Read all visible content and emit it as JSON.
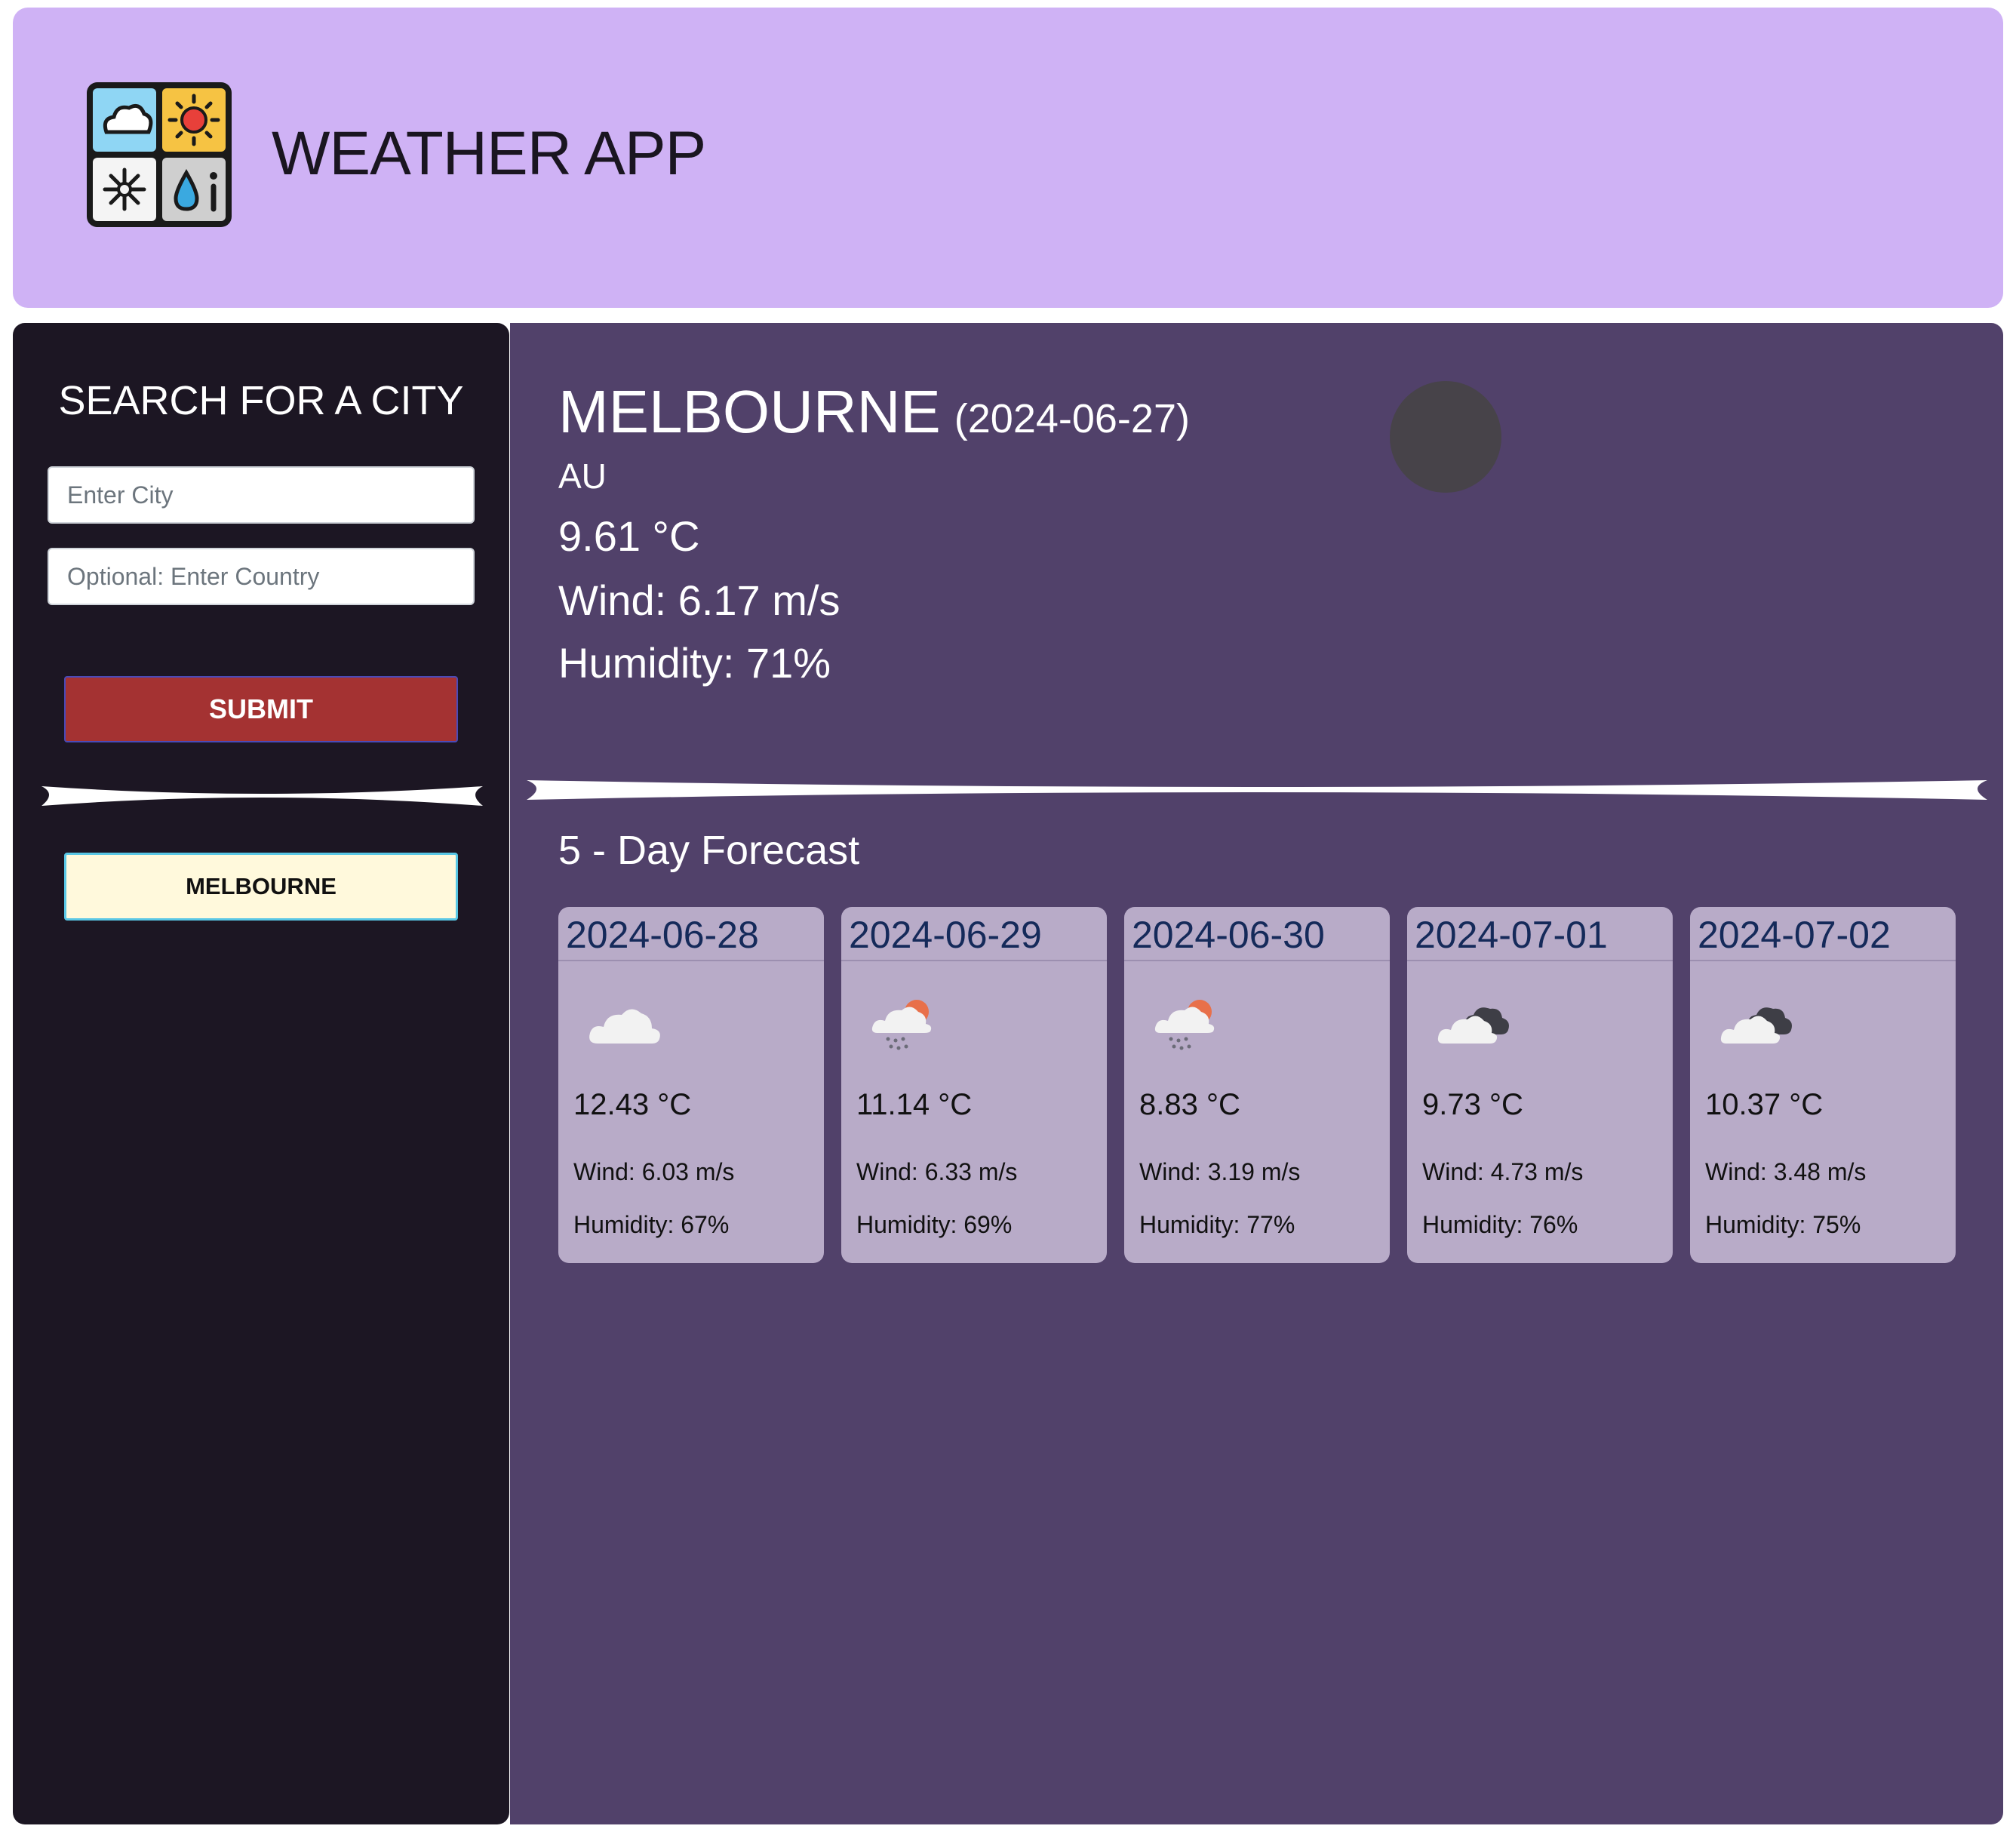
{
  "header": {
    "title": "WEATHER APP",
    "logo_icon": "weather-grid-logo"
  },
  "sidebar": {
    "title": "SEARCH FOR A CITY",
    "city_placeholder": "Enter City",
    "country_placeholder": "Optional: Enter Country",
    "submit_label": "SUBMIT",
    "history": [
      "MELBOURNE"
    ]
  },
  "current": {
    "city": "MELBOURNE",
    "date": "(2024-06-27)",
    "country": "AU",
    "temp": "9.61 °C",
    "wind": "Wind: 6.17 m/s",
    "humidity": "Humidity: 71%"
  },
  "forecast": {
    "title": "5 - Day Forecast",
    "days": [
      {
        "date": "2024-06-28",
        "icon": "cloud-icon",
        "temp": "12.43 °C",
        "wind": "Wind: 6.03 m/s",
        "humidity": "Humidity: 67%"
      },
      {
        "date": "2024-06-29",
        "icon": "sun-rain-icon",
        "temp": "11.14 °C",
        "wind": "Wind: 6.33 m/s",
        "humidity": "Humidity: 69%"
      },
      {
        "date": "2024-06-30",
        "icon": "sun-rain-icon",
        "temp": "8.83 °C",
        "wind": "Wind: 3.19 m/s",
        "humidity": "Humidity: 77%"
      },
      {
        "date": "2024-07-01",
        "icon": "broken-clouds-icon",
        "temp": "9.73 °C",
        "wind": "Wind: 4.73 m/s",
        "humidity": "Humidity: 76%"
      },
      {
        "date": "2024-07-02",
        "icon": "broken-clouds-icon",
        "temp": "10.37 °C",
        "wind": "Wind: 3.48 m/s",
        "humidity": "Humidity: 75%"
      }
    ]
  },
  "colors": {
    "header_bg": "#cfb2f5",
    "sidebar_bg": "#1c1623",
    "main_bg": "#51416a",
    "card_bg": "#b8abc8",
    "submit_bg": "#a43232",
    "history_bg": "#fff9dc"
  }
}
